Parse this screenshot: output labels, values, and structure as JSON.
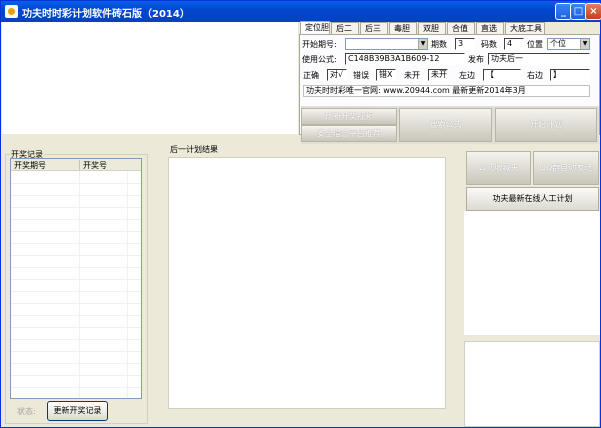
{
  "window": {
    "title": "功夫时时彩计划软件砖石版（2014）"
  },
  "tabs": [
    "定位胆",
    "后二",
    "后三",
    "毒胆",
    "双胆",
    "合值",
    "直选",
    "大底工具"
  ],
  "form": {
    "start_period_label": "开始期号:",
    "start_period_value": "",
    "periods_label": "期数",
    "periods_value": "3",
    "code_count_label": "码数",
    "code_count_value": "4",
    "position_label": "位置",
    "position_value": "个位",
    "formula_label": "使用公式:",
    "formula_value": "C148B39B3A1B609-12",
    "publish_label": "发布",
    "publish_value": "功夫后一",
    "correct_label": "正确",
    "correct_value": "对√",
    "wrong_label": "错误",
    "wrong_value": "错X",
    "not_open_label": "未开",
    "not_open_value": "未开",
    "left_label": "左边",
    "left_value": "【",
    "right_label": "右边",
    "right_value": "】",
    "site_text": "功夫时时彩唯一官网: www.20944.com 最新更新2014年3月"
  },
  "buttons": {
    "refresh_stats": "刷新开奖视频",
    "safe_platform": "安全信誉平台推荐",
    "search_formula": "搜索公式",
    "start_plan": "开始计划",
    "formula_favorites": "公式收藏夹",
    "qq_auto_send": "QQ群自动发送",
    "latest_online_plan": "功夫最新在线人工计划",
    "update_records": "更新开奖记录"
  },
  "records": {
    "legend": "开奖记录",
    "col_period": "开奖期号",
    "col_number": "开奖号"
  },
  "status": {
    "label": "状态:"
  },
  "plan": {
    "label": "后一计划结果"
  }
}
